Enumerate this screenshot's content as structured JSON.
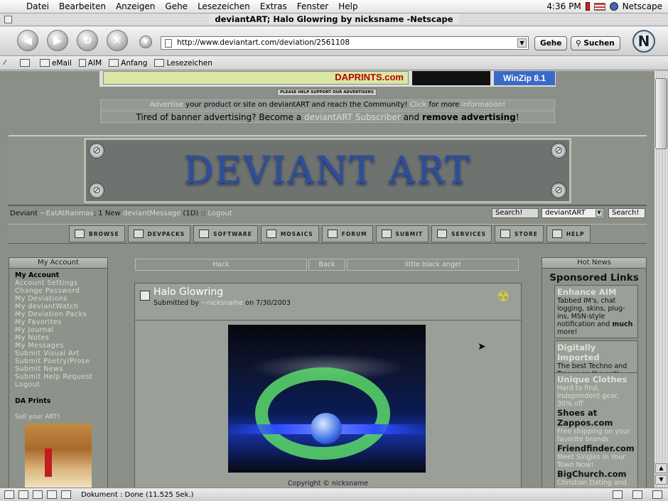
{
  "menubar": {
    "items": [
      "Datei",
      "Bearbeiten",
      "Anzeigen",
      "Gehe",
      "Lesezeichen",
      "Extras",
      "Fenster",
      "Help"
    ],
    "clock": "4:36 PM",
    "app_name": "Netscape"
  },
  "window": {
    "title": "deviantART; Halo Glowring by nicksname -Netscape"
  },
  "navbar": {
    "url": "http://www.deviantart.com/deviation/2561108",
    "go_label": "Gehe",
    "search_label": "Suchen",
    "logo_letter": "N"
  },
  "personal_toolbar": {
    "items": [
      "eMail",
      "AIM",
      "Anfang",
      "Lesezeichen"
    ]
  },
  "ads": {
    "banner_text": "DAPRINTS.com",
    "winzip_text": "WinZip 8.1",
    "support_text": "PLEASE HELP SUPPORT OUR ADVERTISERS",
    "advertise_line": [
      "Advertise",
      " your product or site on deviantART and reach the Community! ",
      "Click",
      " for more ",
      "information!"
    ],
    "tired_line": [
      "Tired of banner advertising? Become a ",
      "deviantART Subscriber",
      " and ",
      "remove advertising",
      "!"
    ]
  },
  "logo": {
    "title": "DEVIANT ART"
  },
  "userbar": {
    "user": [
      "Deviant ",
      "~EatAtRanmas",
      "; 1 New ",
      "deviantMessage",
      " (1D) :: ",
      "Logout"
    ],
    "search_label": "Search!",
    "search_scope": "deviantART",
    "search_button": "Search!"
  },
  "nav": {
    "items": [
      "BROWSE",
      "DEVPACKS",
      "SOFTWARE",
      "MOSAICS",
      "FORUM",
      "SUBMIT",
      "SERVICES",
      "STORE",
      "HELP"
    ]
  },
  "left_column": {
    "header": "My Account",
    "title": "My Account",
    "links": [
      "Account Settings",
      "Change Password",
      "My Deviations",
      "My deviantWatch",
      "My Deviation Packs",
      "My Favorites",
      "My Journal",
      "My Notes",
      "My Messages",
      "Submit Visual Art",
      "Submit Poetry/Prose",
      "Submit News",
      "Submit Help Request",
      "Logout"
    ],
    "prints_title": "DA Prints",
    "sell_text": "Sell your ART!"
  },
  "main": {
    "tabs": [
      "Hack",
      "Back",
      "little black angel"
    ],
    "deviation_title": "Halo Glowring",
    "submitted": [
      "Submitted by ",
      "~nicksname",
      " on 7/30/2003"
    ],
    "copyright": "Copyright © nicksname"
  },
  "right_column": {
    "header": "Hot News",
    "sponsored": "Sponsored Links",
    "box1": {
      "title": "Enhance AIM",
      "body": "Tabbed IM's, chat logging, skins, plug-ins, MSN-style notification and ",
      "bold": "much",
      "tail": " more!"
    },
    "box2": {
      "title": "Digitally Imported",
      "body": "The best Techno and Trance on the net!"
    },
    "box3": {
      "title": "Unique Clothes",
      "l1": "Hard to find, independent gear, 30% off",
      "t2": "Shoes at Zappos.com",
      "l2": "Free shipping on your favorite brands",
      "t3": "Friendfinder.com",
      "l3": "Meet Singles In Your Town Now!",
      "t4": "BigChurch.com",
      "l4": "Christian Dating and"
    }
  },
  "statusbar": {
    "text": "Dokument : Done (11.525 Sek.)"
  }
}
